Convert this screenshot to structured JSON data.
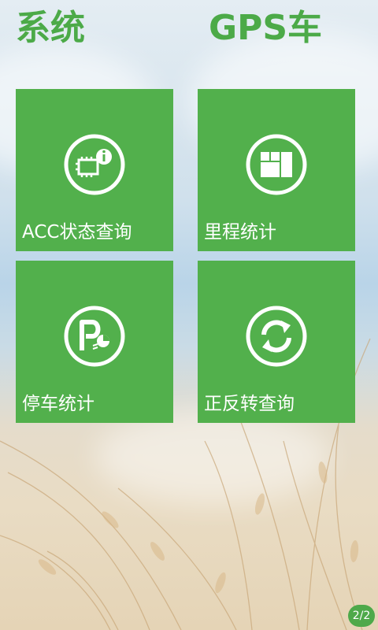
{
  "header": {
    "title_left": "系统",
    "title_right": "GPS车"
  },
  "tiles": [
    {
      "label": "ACC状态查询",
      "icon": "acc-chip-info-icon"
    },
    {
      "label": "里程统计",
      "icon": "mileage-grid-icon"
    },
    {
      "label": "停车统计",
      "icon": "parking-icon"
    },
    {
      "label": "正反转查询",
      "icon": "rotation-refresh-icon"
    }
  ],
  "pager": {
    "text": "2/2"
  },
  "colors": {
    "accent": "#52b04c",
    "title": "#4caa48",
    "tile_text": "#ffffff"
  }
}
